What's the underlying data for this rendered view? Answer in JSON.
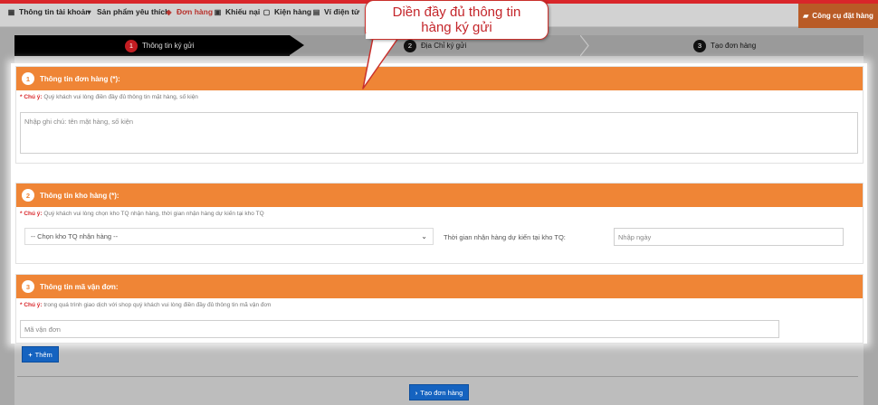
{
  "nav": {
    "items": [
      {
        "label": "Thông tin tài khoản",
        "icon": "account-icon"
      },
      {
        "label": "Sản phẩm yêu thích",
        "icon": "heart-icon"
      },
      {
        "label": "Đơn hàng",
        "icon": "orders-icon"
      },
      {
        "label": "Khiếu nại",
        "icon": "complaint-icon"
      },
      {
        "label": "Kiện hàng",
        "icon": "package-icon"
      },
      {
        "label": "Ví điện tử",
        "icon": "wallet-icon"
      }
    ],
    "tool_button": "Công cụ đặt hàng"
  },
  "steps": [
    {
      "num": "1",
      "label": "Thông tin ký gửi"
    },
    {
      "num": "2",
      "label": "Địa Chỉ ký gửi"
    },
    {
      "num": "3",
      "label": "Tạo đơn hàng"
    }
  ],
  "callout": {
    "line1": "Diền đầy đủ thông tin",
    "line2": "hàng ký gửi"
  },
  "section1": {
    "num": "1",
    "title": "Thông tin đơn hàng (*):",
    "note_prefix": "* Chú ý:",
    "note": " Quý khách vui lòng điền đầy đủ thông tin mặt hàng, số kiện",
    "placeholder": "Nhập ghi chú: tên mặt hàng, số kiện"
  },
  "section2": {
    "num": "2",
    "title": "Thông tin kho hàng (*):",
    "note_prefix": "* Chú ý:",
    "note": " Quý khách vui lòng chọn kho TQ nhận hàng, thời gian nhận hàng dự kiến tại kho TQ",
    "select_value": "-- Chọn kho TQ nhận hàng --",
    "date_label": "Thời gian nhận hàng dự kiến tại kho TQ:",
    "date_placeholder": "Nhập ngày"
  },
  "section3": {
    "num": "3",
    "title": "Thông tin mã vận đơn:",
    "note_prefix": "* Chú ý:",
    "note": " trong quá trình giao dịch với shop quý khách vui lòng điền đầy đủ thông tin mã vận đơn",
    "placeholder": "Mã vận đơn"
  },
  "buttons": {
    "add": "Thêm",
    "create": "Tạo đơn hàng"
  },
  "colors": {
    "accent_orange": "#ef8536",
    "brand_red": "#d9262a",
    "primary_blue": "#1563c0"
  }
}
